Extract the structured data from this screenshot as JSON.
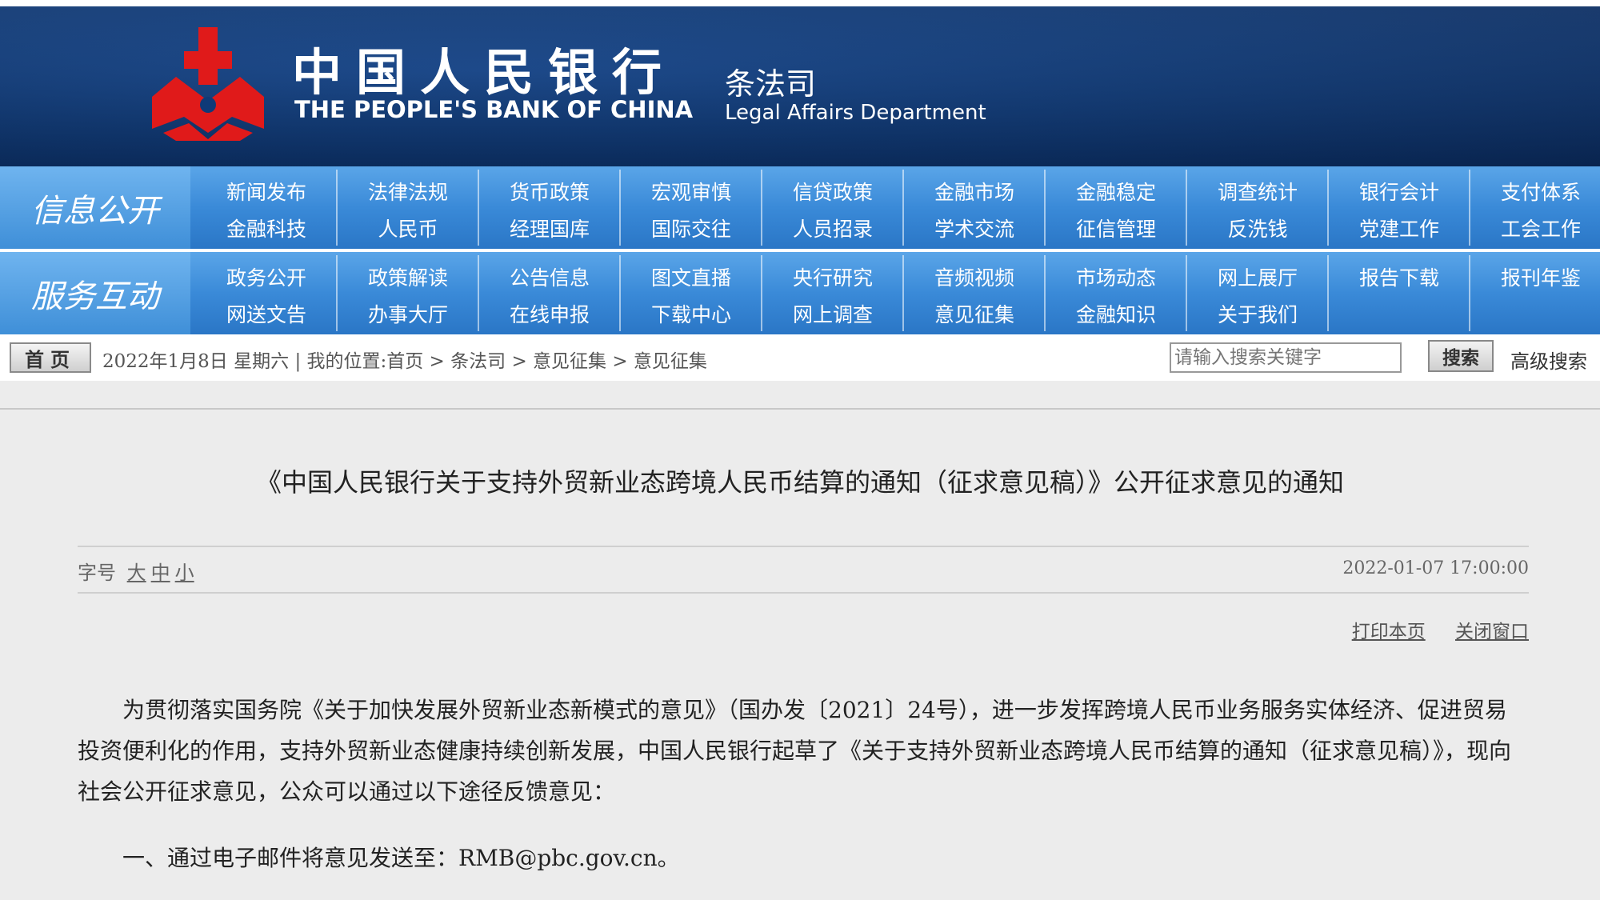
{
  "header": {
    "brand_cn": "中国人民银行",
    "brand_en": "THE PEOPLE'S BANK OF CHINA",
    "dept_cn": "条法司",
    "dept_en": "Legal Affairs Department"
  },
  "nav": {
    "groups": [
      {
        "label": "信息公开",
        "rows": [
          [
            "新闻发布",
            "法律法规",
            "货币政策",
            "宏观审慎",
            "信贷政策",
            "金融市场",
            "金融稳定",
            "调查统计",
            "银行会计",
            "支付体系"
          ],
          [
            "金融科技",
            "人民币",
            "经理国库",
            "国际交往",
            "人员招录",
            "学术交流",
            "征信管理",
            "反洗钱",
            "党建工作",
            "工会工作"
          ]
        ]
      },
      {
        "label": "服务互动",
        "rows": [
          [
            "政务公开",
            "政策解读",
            "公告信息",
            "图文直播",
            "央行研究",
            "音频视频",
            "市场动态",
            "网上展厅",
            "报告下载",
            "报刊年鉴"
          ],
          [
            "网送文告",
            "办事大厅",
            "在线申报",
            "下载中心",
            "网上调查",
            "意见征集",
            "金融知识",
            "关于我们"
          ]
        ]
      }
    ]
  },
  "crumb": {
    "home": "首页",
    "date": "2022年1月8日 星期六",
    "location": "我的位置:首页 > 条法司 > 意见征集 > 意见征集",
    "search_placeholder": "请输入搜索关键字",
    "search_button": "搜索",
    "advanced": "高级搜索"
  },
  "article": {
    "title": "《中国人民银行关于支持外贸新业态跨境人民币结算的通知（征求意见稿）》公开征求意见的通知",
    "font_label": "字号",
    "font_large": "大",
    "font_medium": "中",
    "font_small": "小",
    "date": "2022-01-07 17:00:00",
    "print": "打印本页",
    "close": "关闭窗口",
    "paragraph1": "为贯彻落实国务院《关于加快发展外贸新业态新模式的意见》（国办发〔2021〕24号），进一步发挥跨境人民币业务服务实体经济、促进贸易投资便利化的作用，支持外贸新业态健康持续创新发展，中国人民银行起草了《关于支持外贸新业态跨境人民币结算的通知（征求意见稿）》，现向社会公开征求意见，公众可以通过以下途径反馈意见：",
    "item1": "一、通过电子邮件将意见发送至：RMB@pbc.gov.cn。"
  }
}
